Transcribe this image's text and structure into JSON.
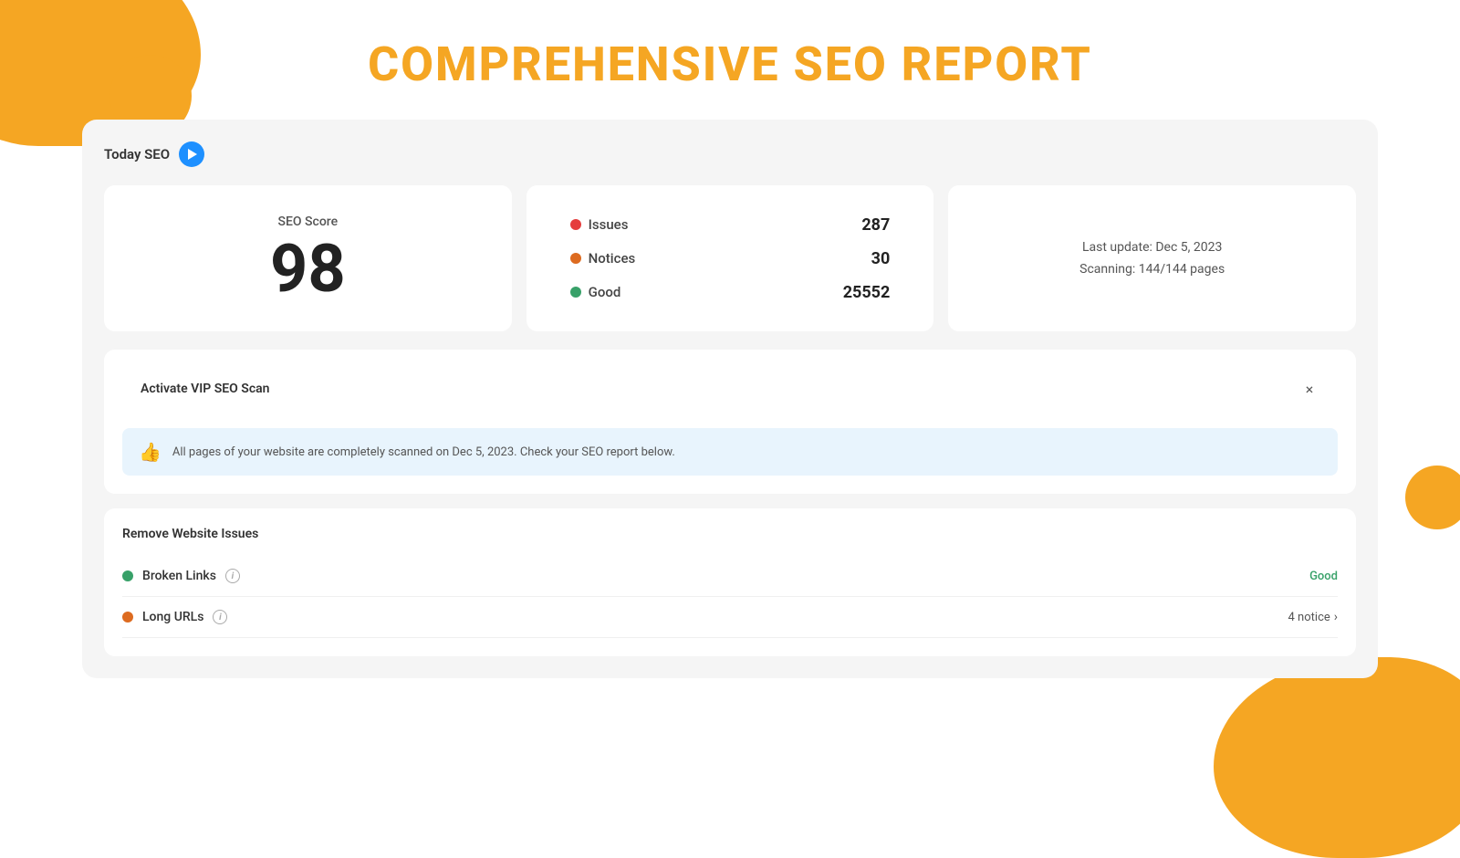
{
  "header": {
    "title": "COMPREHENSIVE SEO REPORT"
  },
  "today_seo": {
    "label": "Today SEO",
    "play_button_label": "Play"
  },
  "seo_score_card": {
    "label": "SEO Score",
    "value": "98"
  },
  "stats_card": {
    "items": [
      {
        "label": "Issues",
        "count": "287",
        "dot_color": "red"
      },
      {
        "label": "Notices",
        "count": "30",
        "dot_color": "orange"
      },
      {
        "label": "Good",
        "count": "25552",
        "dot_color": "green"
      }
    ]
  },
  "last_update_card": {
    "last_update": "Last update: Dec 5, 2023",
    "scanning": "Scanning: 144/144 pages"
  },
  "vip_section": {
    "label": "Activate VIP SEO Scan",
    "close_label": "×"
  },
  "info_box": {
    "text": "All pages of your website are completely scanned on Dec 5, 2023. Check your SEO report below."
  },
  "website_issues": {
    "title": "Remove Website Issues",
    "items": [
      {
        "dot_color": "green",
        "name": "Broken Links",
        "status": "Good",
        "status_type": "good"
      },
      {
        "dot_color": "orange",
        "name": "Long URLs",
        "status": "4 notice",
        "status_type": "notice"
      }
    ]
  }
}
